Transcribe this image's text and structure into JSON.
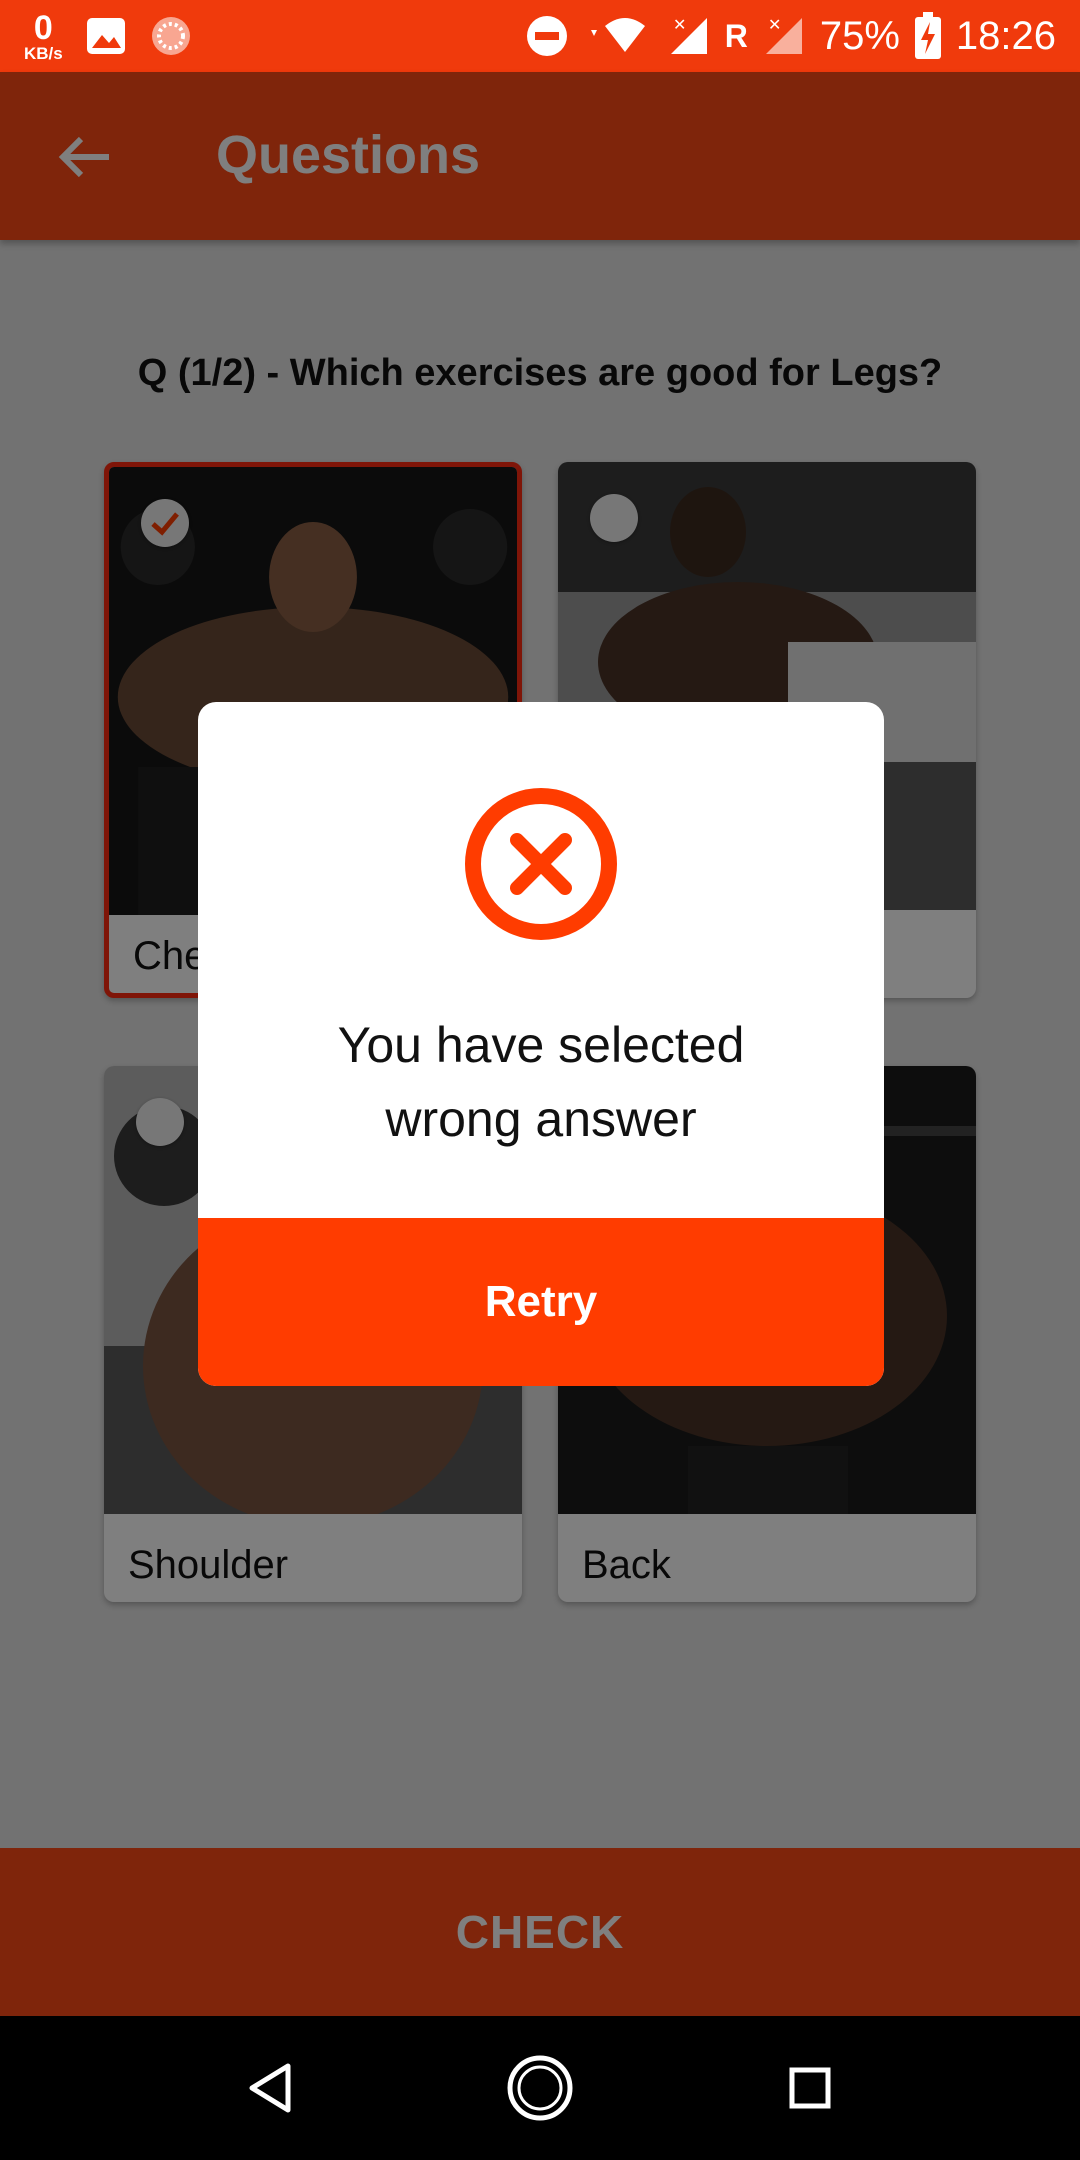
{
  "status_bar": {
    "net_speed_value": "0",
    "net_speed_unit": "KB/s",
    "roaming": "R",
    "battery": "75%",
    "time": "18:26"
  },
  "app_bar": {
    "title": "Questions"
  },
  "question": {
    "text": "Q (1/2) - Which exercises are good for Legs?"
  },
  "options": [
    {
      "label": "Chest",
      "selected": true
    },
    {
      "label": "",
      "selected": false
    },
    {
      "label": "Shoulder",
      "selected": false
    },
    {
      "label": "Back",
      "selected": false
    }
  ],
  "check_button": {
    "label": "CHECK"
  },
  "dialog": {
    "message_line1": "You have selected",
    "message_line2": "wrong answer",
    "retry_label": "Retry",
    "icon": "close-circle-icon"
  },
  "colors": {
    "primary": "#ff4a16",
    "accent": "#ff3c00"
  }
}
